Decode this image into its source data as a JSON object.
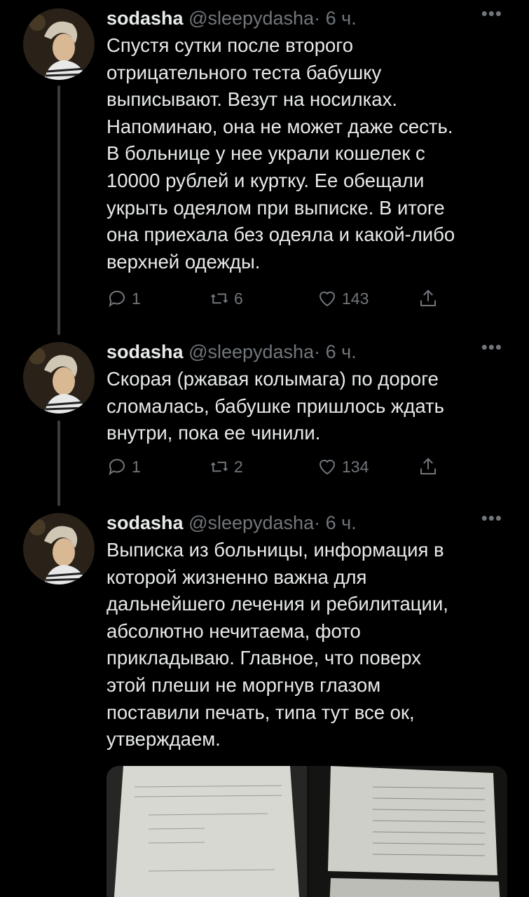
{
  "colors": {
    "background": "#000000",
    "text": "#e7e9ea",
    "secondary": "#71767b",
    "thread_line": "#3a3d40"
  },
  "tweets": [
    {
      "name": "sodasha",
      "handle": "@sleepydasha",
      "separator": "·",
      "time": "6 ч.",
      "more": "•••",
      "lines": [
        "Спустя сутки после второго",
        "отрицательного теста бабушку",
        "выписывают. Везут на носилках.",
        "Напоминаю, она не может даже сесть.",
        "В больнице у нее украли кошелек с",
        "10000 рублей и куртку. Ее обещали",
        "укрыть одеялом при выписке. В итоге",
        "она приехала без одеяла и какой-либо",
        "верхней одежды."
      ],
      "replies": "1",
      "retweets": "6",
      "likes": "143"
    },
    {
      "name": "sodasha",
      "handle": "@sleepydasha",
      "separator": "·",
      "time": "6 ч.",
      "more": "•••",
      "lines": [
        "Скорая (ржавая колымага) по дороге",
        "сломалась, бабушке пришлось ждать",
        "внутри, пока ее чинили."
      ],
      "replies": "1",
      "retweets": "2",
      "likes": "134"
    },
    {
      "name": "sodasha",
      "handle": "@sleepydasha",
      "separator": "·",
      "time": "6 ч.",
      "more": "•••",
      "lines": [
        "Выписка из больницы, информация в",
        "которой жизненно важна для",
        "дальнейшего лечения и ребилитации,",
        "абсолютно нечитаема, фото",
        "прикладываю. Главное, что поверх",
        "этой плеши не моргнув глазом",
        "поставили печать, типа тут все ок,",
        "утверждаем."
      ]
    }
  ],
  "icons": {
    "reply": "reply-icon",
    "retweet": "retweet-icon",
    "like": "like-icon",
    "share": "share-icon",
    "more": "more-icon"
  }
}
